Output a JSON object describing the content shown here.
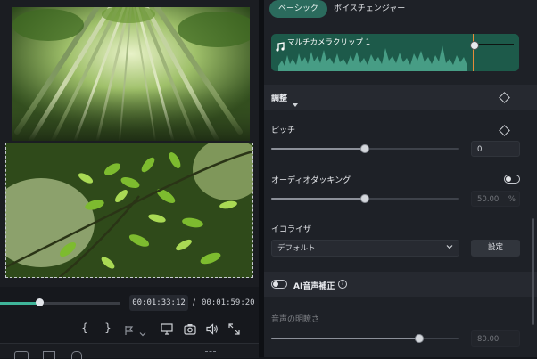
{
  "tabs": [
    {
      "label": "ベーシック",
      "active": true
    },
    {
      "label": "ボイスチェンジャー",
      "active": false
    }
  ],
  "audio_clip": {
    "name": "マルチカメラクリップ 1",
    "color": "#1d5a4a"
  },
  "adjust": {
    "label": "調整"
  },
  "pitch": {
    "label": "ピッチ",
    "value": "0",
    "level": 0.5
  },
  "ducking": {
    "label": "オーディオダッキング",
    "value": "50.00",
    "unit": "%",
    "level": 0.5,
    "enabled": false
  },
  "equalizer": {
    "label": "イコライザ",
    "selected": "デフォルト",
    "settings_label": "設定"
  },
  "ai_enhance": {
    "label": "AI音声補正",
    "enabled": false
  },
  "voice_clarity": {
    "label": "音声の明瞭さ",
    "value": "80.00",
    "level": 0.8
  },
  "player": {
    "current_time": "00:01:33:12",
    "separator": "/",
    "total_time": "00:01:59:20",
    "progress": 0.45
  },
  "icons": [
    "mark-in-icon",
    "mark-out-icon",
    "marker-flag-icon",
    "chevron-down-icon",
    "monitor-icon",
    "snapshot-icon",
    "volume-icon",
    "fullscreen-icon",
    "diamond-keyframe-icon",
    "toggle-icon",
    "info-icon"
  ],
  "colors": {
    "accent": "#3a8a76",
    "panel": "#1e2127",
    "waveform": "#1d5a4a"
  }
}
